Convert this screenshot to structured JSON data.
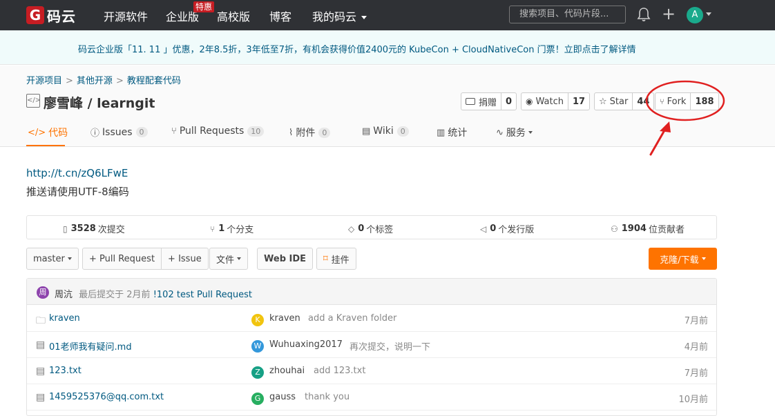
{
  "nav": {
    "logo_glyph": "G",
    "logo_text": "码云",
    "items": [
      "开源软件",
      "企业版",
      "高校版",
      "博客",
      "我的码云"
    ],
    "badge": "特惠",
    "search_placeholder": "搜索项目、代码片段...",
    "avatar_letter": "A"
  },
  "banner": {
    "text": "码云企业版「11. 11 」优惠，2年8.5折，3年低至7折，有机会获得价值2400元的 KubeCon + CloudNativeCon 门票！立即点击了解详情"
  },
  "breadcrumb": [
    "开源项目",
    "其他开源",
    "教程配套代码"
  ],
  "repo": {
    "icon_glyph": "</>",
    "title": "廖雪峰 / learngit",
    "actions": {
      "donate": {
        "label": "捐赠",
        "count": "0"
      },
      "watch": {
        "label": "Watch",
        "count": "17"
      },
      "star": {
        "label": "Star",
        "count": "44"
      },
      "fork": {
        "label": "Fork",
        "count": "188"
      }
    }
  },
  "tabs": [
    {
      "label": "代码",
      "count": ""
    },
    {
      "label": "Issues",
      "count": "0"
    },
    {
      "label": "Pull Requests",
      "count": "10"
    },
    {
      "label": "附件",
      "count": "0"
    },
    {
      "label": "Wiki",
      "count": "0"
    },
    {
      "label": "统计",
      "count": ""
    },
    {
      "label": "服务",
      "count": ""
    }
  ],
  "description": {
    "link": "http://t.cn/zQ6LFwE",
    "text": "推送请使用UTF-8编码"
  },
  "stats": [
    {
      "value": "3528",
      "label": "次提交"
    },
    {
      "value": "1",
      "label": "个分支"
    },
    {
      "value": "0",
      "label": "个标签"
    },
    {
      "value": "0",
      "label": "个发行版"
    },
    {
      "value": "1904",
      "label": "位贡献者"
    }
  ],
  "toolbar": {
    "branch": "master",
    "pull_request": "+ Pull Request",
    "issue": "+ Issue",
    "file": "文件",
    "web_ide": "Web IDE",
    "widget": "挂件",
    "clone": "克隆/下载"
  },
  "last_commit": {
    "avatar_letter": "周",
    "author": "周沆",
    "prefix": "最后提交于 2月前",
    "message": "!102 test Pull Request"
  },
  "files": [
    {
      "type": "folder",
      "name": "kraven",
      "avatar": "K",
      "avatar_color": "#f1c40f",
      "user": "kraven",
      "message": "add a Kraven folder",
      "time": "7月前"
    },
    {
      "type": "file",
      "name": "01老师我有疑问.md",
      "avatar": "W",
      "avatar_color": "#3498db",
      "user": "Wuhuaxing2017",
      "message": "再次提交，说明一下",
      "time": "4月前"
    },
    {
      "type": "file",
      "name": "123.txt",
      "avatar": "Z",
      "avatar_color": "#16a085",
      "user": "zhouhai",
      "message": "add 123.txt",
      "time": "7月前"
    },
    {
      "type": "file",
      "name": "1459525376@qq.com.txt",
      "avatar": "G",
      "avatar_color": "#27ae60",
      "user": "gauss",
      "message": "thank you",
      "time": "10月前"
    }
  ],
  "colors": {
    "nav_bg": "#2f3135",
    "accent": "#fe7300",
    "link": "#005980",
    "annotation": "#e02020"
  }
}
